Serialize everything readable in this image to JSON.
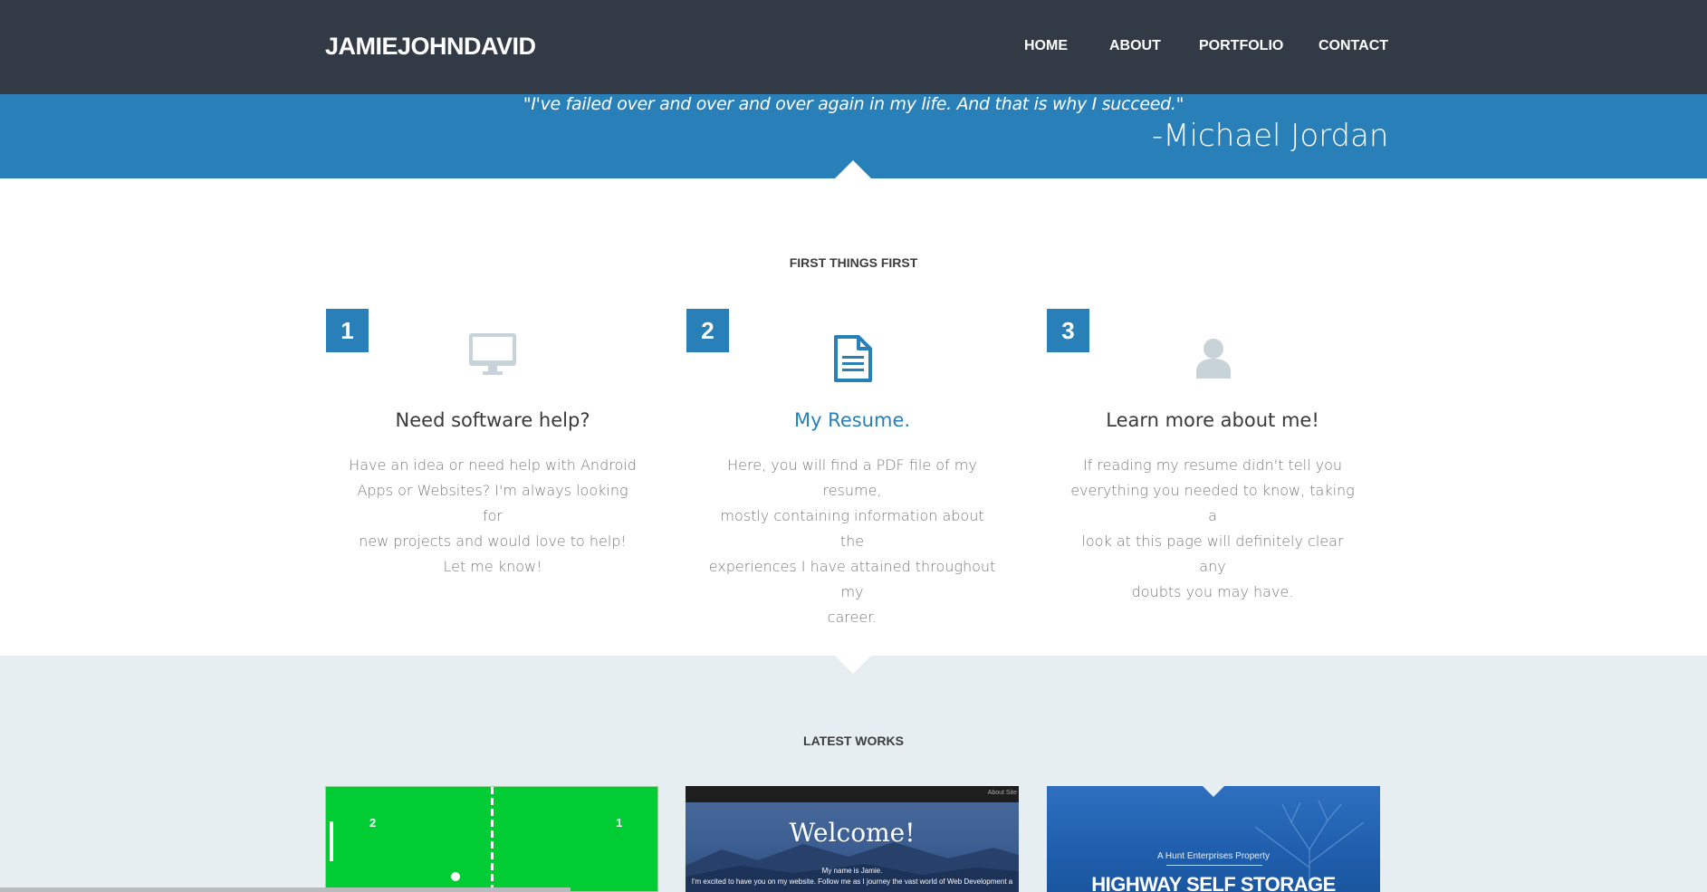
{
  "navbar": {
    "brand": "JAMIEJOHNDAVID",
    "links": [
      {
        "label": "HOME"
      },
      {
        "label": "ABOUT"
      },
      {
        "label": "PORTFOLIO"
      },
      {
        "label": "CONTACT"
      }
    ]
  },
  "quote": {
    "text": "\"I've failed over and over and over again in my life. And that is why I succeed.\"",
    "author": "-Michael Jordan"
  },
  "first_things": {
    "title": "FIRST THINGS FIRST",
    "cards": [
      {
        "number": "1",
        "icon": "monitor-icon",
        "title": "Need software help?",
        "body": [
          "Have an idea or need help with Android",
          "Apps or Websites? I'm always looking for",
          "new projects and would love to help!",
          "Let me know!"
        ]
      },
      {
        "number": "2",
        "icon": "document-icon",
        "title": "My Resume.",
        "body": [
          "Here, you will find a PDF file of my resume,",
          "mostly containing information about the",
          "experiences I have attained throughout my",
          "career."
        ]
      },
      {
        "number": "3",
        "icon": "user-icon",
        "title": "Learn more about me!",
        "body": [
          "If reading my resume didn't tell you",
          "everything you needed to know, taking a",
          "look at this page will definitely clear any",
          "doubts you may have."
        ]
      }
    ]
  },
  "latest_works": {
    "title": "LATEST WORKS",
    "items": [
      {
        "score_left": "2",
        "score_right": "1"
      },
      {
        "topbar": "About Site",
        "heading": "Welcome!",
        "line1": "My name is Jamie.",
        "line2": "I'm excited to have you on my website. Follow me as I journey the vast world of Web Development a"
      },
      {
        "tagline": "A Hunt Enterprises Property",
        "name": "HIGHWAY SELF STORAGE"
      }
    ]
  },
  "colors": {
    "navbar_bg": "#323a45",
    "accent_blue": "#2980b9",
    "works_bg": "#e7eef2",
    "icon_gray": "#c8d3d9"
  }
}
